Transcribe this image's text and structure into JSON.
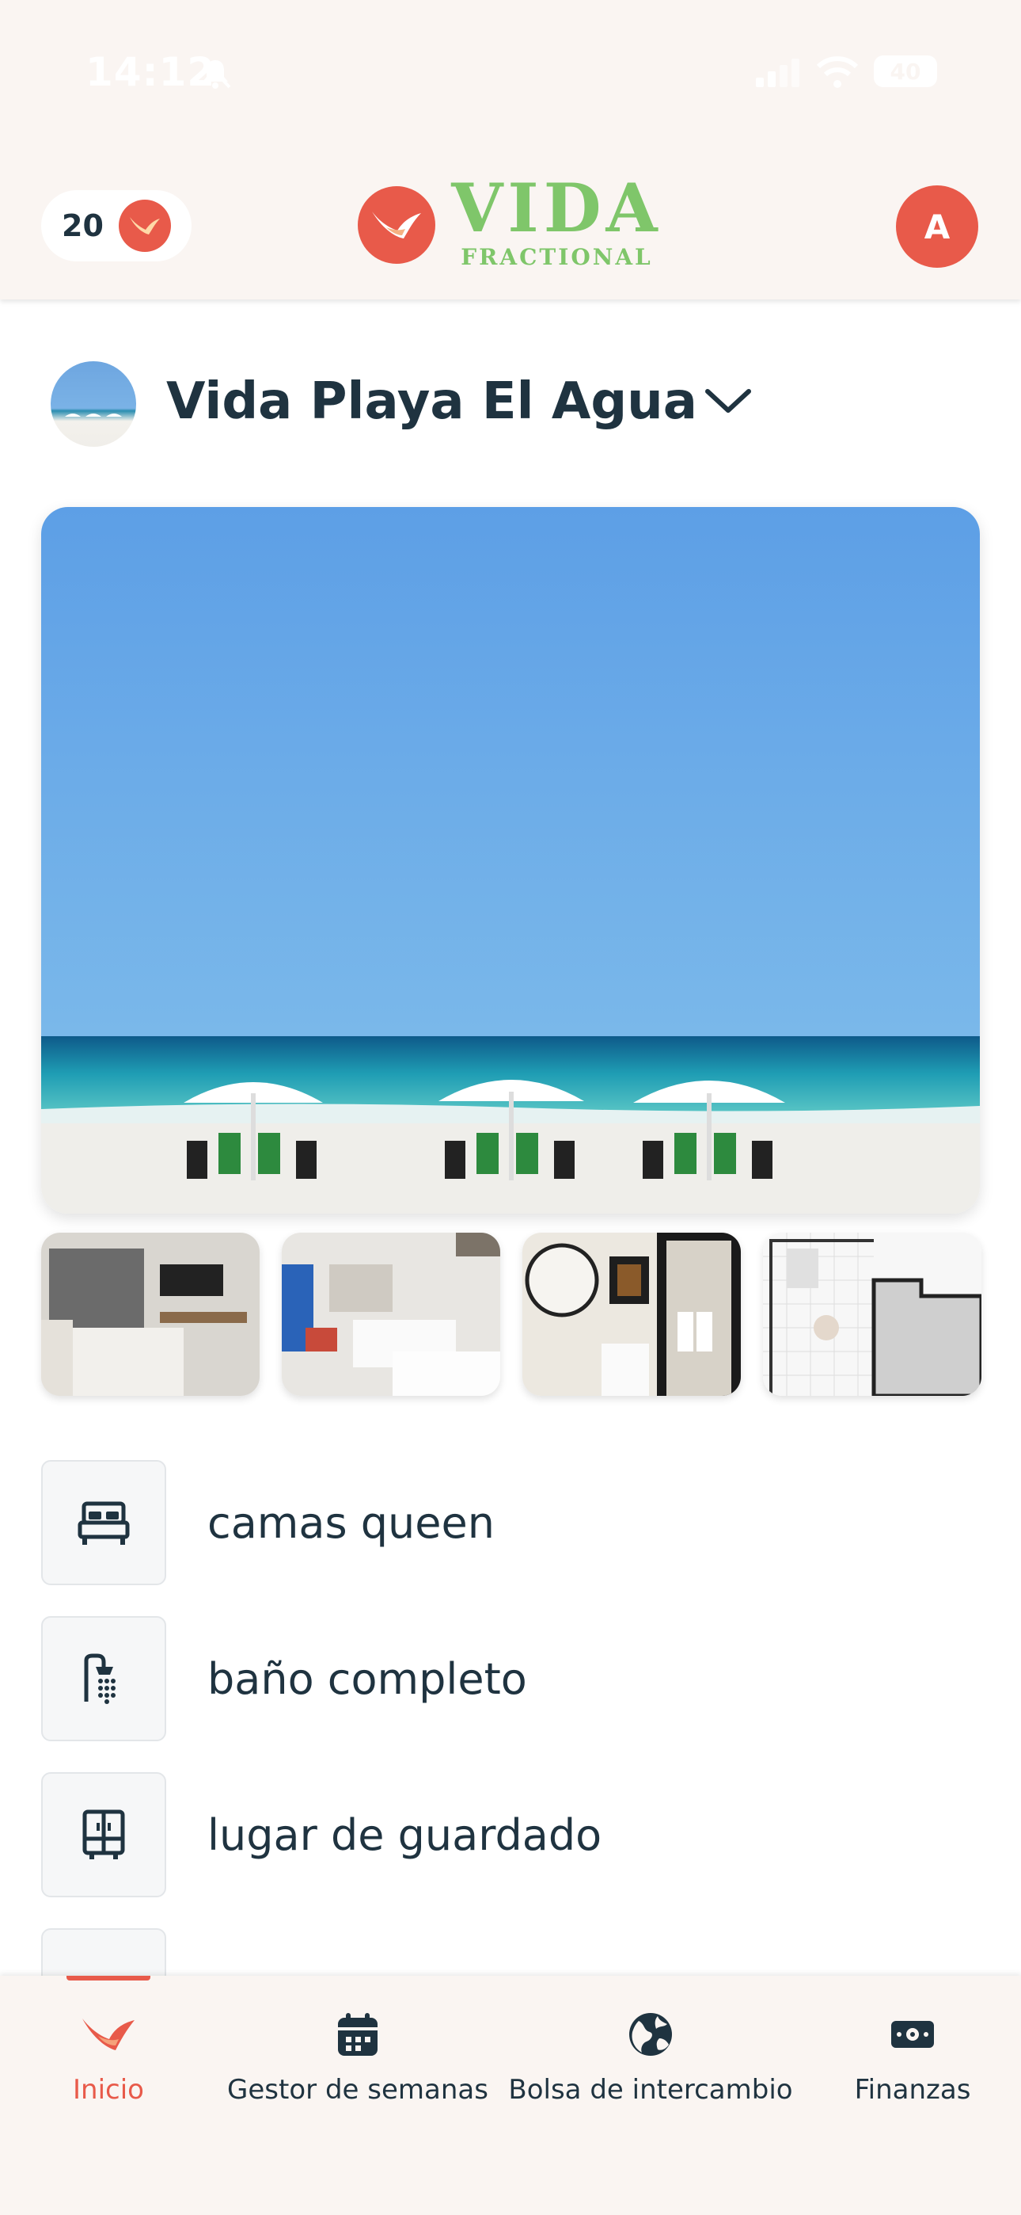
{
  "status_bar": {
    "time": "14:12",
    "battery": "40"
  },
  "header": {
    "points": "20",
    "logo_word": "VIDA",
    "logo_sub": "FRACTIONAL",
    "avatar_initial": "A"
  },
  "property": {
    "name": "Vida Playa El Agua"
  },
  "amenities": [
    {
      "label": "camas queen",
      "icon": "bed-icon"
    },
    {
      "label": "baño completo",
      "icon": "shower-icon"
    },
    {
      "label": "lugar de guardado",
      "icon": "wardrobe-icon"
    }
  ],
  "nav": [
    {
      "label": "Inicio",
      "icon": "bird-icon",
      "active": true
    },
    {
      "label": "Gestor de semanas",
      "icon": "calendar-icon",
      "active": false
    },
    {
      "label": "Bolsa de intercambio",
      "icon": "globe-icon",
      "active": false
    },
    {
      "label": "Finanzas",
      "icon": "cash-icon",
      "active": false
    }
  ],
  "colors": {
    "accent": "#e85a4a",
    "brand_green": "#7fc66a",
    "text": "#1f3340",
    "header_bg": "#faf5f2"
  }
}
